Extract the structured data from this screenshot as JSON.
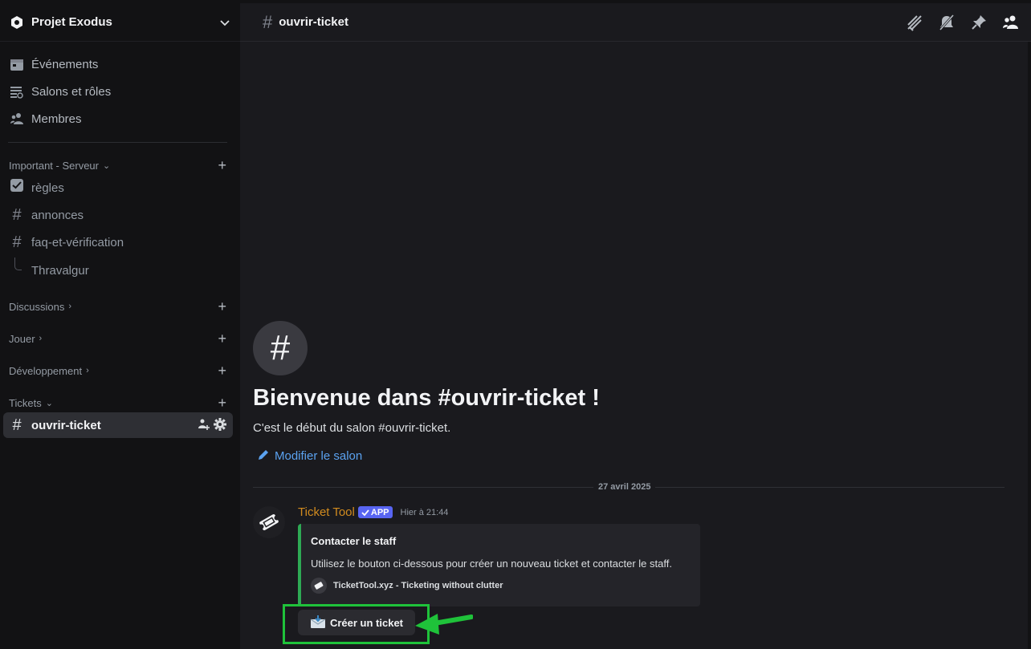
{
  "guild": {
    "name": "Projet Exodus"
  },
  "nav": [
    {
      "label": "Événements",
      "icon": "calendar-icon"
    },
    {
      "label": "Salons et rôles",
      "icon": "channels-roles-icon"
    },
    {
      "label": "Membres",
      "icon": "members-icon"
    }
  ],
  "categories": {
    "important": "Important - Serveur",
    "discussions": "Discussions",
    "jouer": "Jouer",
    "developpement": "Développement",
    "tickets": "Tickets"
  },
  "channels": {
    "regles": "règles",
    "annonces": "annonces",
    "faq": "faq-et-vérification",
    "thread": "Thravalgur",
    "ouvrir_ticket": "ouvrir-ticket"
  },
  "header": {
    "channel_name": "ouvrir-ticket"
  },
  "welcome": {
    "title": "Bienvenue dans #ouvrir-ticket !",
    "subtitle": "C'est le début du salon #ouvrir-ticket.",
    "edit_link": "Modifier le salon"
  },
  "date_divider": "27 avril 2025",
  "message": {
    "author": "Ticket Tool",
    "badge": "APP",
    "timestamp": "Hier à 21:44",
    "embed": {
      "title": "Contacter le staff",
      "description": "Utilisez le bouton ci-dessous pour créer un nouveau ticket et contacter le staff.",
      "footer": "TicketTool.xyz - Ticketing without clutter",
      "color": "#2eaa54"
    },
    "button_label": "Créer un ticket"
  },
  "colors": {
    "accent_link": "#5ba2f0",
    "author": "#d18b1f",
    "badge": "#5865f2",
    "highlight": "#1fc23a"
  }
}
